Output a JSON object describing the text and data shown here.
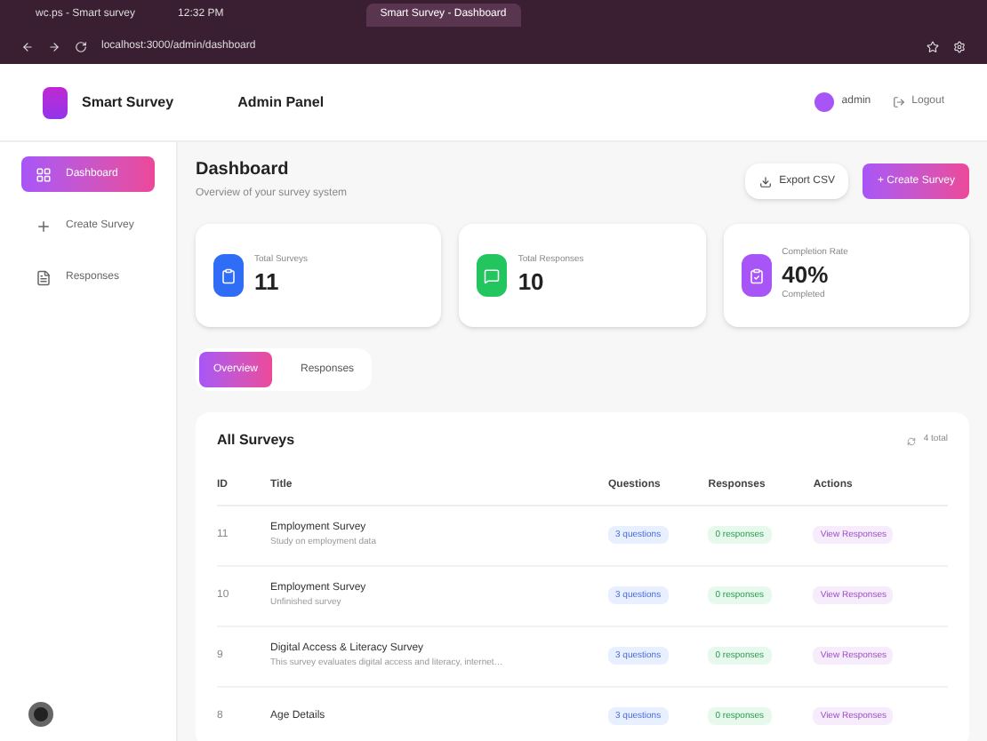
{
  "browser": {
    "tabs": [
      {
        "label": "wc.ps - Smart survey",
        "selected": false
      },
      {
        "label": "12:32 PM",
        "selected": false
      },
      {
        "label": "Smart Survey - Dashboard",
        "selected": true
      }
    ],
    "address": "localhost:3000/admin/dashboard"
  },
  "header": {
    "brand": "Smart Survey",
    "title": "Admin Panel",
    "user": "admin",
    "logout": "Logout"
  },
  "sidebar": {
    "items": [
      {
        "label": "Dashboard",
        "selected": true
      },
      {
        "label": "Create Survey",
        "selected": false
      },
      {
        "label": "Responses",
        "selected": false
      }
    ]
  },
  "page": {
    "title": "Dashboard",
    "subtitle": "Overview of your survey system",
    "export": "Export CSV",
    "create": "+ Create Survey"
  },
  "stats": [
    {
      "label": "Total Surveys",
      "value": "11",
      "color": "#2f6df6"
    },
    {
      "label": "Total Responses",
      "value": "10",
      "color": "#22c55e"
    },
    {
      "label": "Completion Rate",
      "value": "40%",
      "color": "#a855f7",
      "note": "Completed"
    }
  ],
  "view_tabs": [
    {
      "label": "Overview",
      "selected": true
    },
    {
      "label": "Responses",
      "selected": false
    }
  ],
  "table": {
    "title": "All Surveys",
    "count": "4 total",
    "columns": [
      "ID",
      "Title",
      "Questions",
      "Responses",
      "Actions"
    ],
    "rows": [
      {
        "id": "11",
        "title": "Employment Survey",
        "desc": "Study on employment data",
        "questions": "3 questions",
        "responses": "0 responses",
        "action": "View Responses"
      },
      {
        "id": "10",
        "title": "Employment Survey",
        "desc": "Unfinished survey",
        "questions": "3 questions",
        "responses": "0 responses",
        "action": "View Responses"
      },
      {
        "id": "9",
        "title": "Digital Access & Literacy Survey",
        "desc": "This survey evaluates digital access and literacy, internet…",
        "questions": "3 questions",
        "responses": "0 responses",
        "action": "View Responses"
      },
      {
        "id": "8",
        "title": "Age Details",
        "questions": "3 questions",
        "responses": "0 responses",
        "action": "View Responses"
      }
    ]
  }
}
